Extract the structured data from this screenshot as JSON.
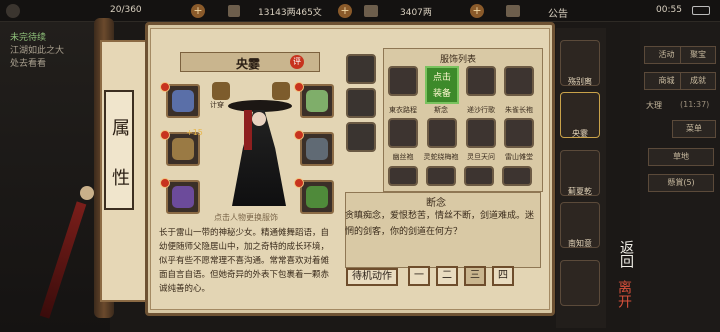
{
  "topbar": {
    "stat1": "20/360",
    "stat2": "13143两465文",
    "stat3": "3407两",
    "notice": "公告",
    "time": "00:55"
  },
  "left": {
    "quest_title": "未完待续",
    "quest_line1": "江湖如此之大",
    "quest_line2": "处去看看"
  },
  "scroll": {
    "chars": [
      "属",
      "性"
    ]
  },
  "character": {
    "name": "央霎",
    "comment_badge": "评",
    "hint": "点击人物更换服饰",
    "stat_badges": [
      "计穿",
      "必气"
    ],
    "buff": "+15",
    "desc": "长于雷山一带的神秘少女。精通傩舞蹈语，自幼便随师父隐居山中，加之奇特的成长环境，似乎有些不愿常理不喜沟通。常常喜欢对着傩面自言自语。但她奇异的外表下包裹着一颗赤诚纯善的心。"
  },
  "costumes": {
    "title": "服饰列表",
    "click_label": "点击",
    "equip_label": "装备",
    "items": [
      [
        "東衣路程",
        "斯念",
        "递沙行歌",
        "朱雀长袍"
      ],
      [
        "幽丝袍",
        "灵蛇绕梅袍",
        "灵旦天问",
        "雷山傩堂"
      ]
    ]
  },
  "selected": {
    "title": "断念",
    "desc": "贪瞋痴念，爱恨愁苦，情丝不断，剑道难成。迷惘的剑客，你的剑道在何方？"
  },
  "buttons": {
    "idle": "待机动作",
    "pages": [
      "一",
      "二",
      "三",
      "四"
    ]
  },
  "right_menu": {
    "buttons": [
      "活动",
      "聚宝",
      "商城",
      "成就"
    ],
    "big_button": "大理",
    "count": "(11:37)",
    "sub_btn": "菜单",
    "side1": "草地",
    "side2": "懸賞(5)"
  },
  "roster": {
    "members": [
      "殇别离",
      "央霎",
      "薊夏乾",
      "南知意",
      ""
    ]
  },
  "back": {
    "line1": "返回",
    "line2": "离开"
  },
  "colors": {
    "accent_red": "#c7331e",
    "panel_bg": "#e3d5b4",
    "equip_green": "#3d8a2a"
  }
}
